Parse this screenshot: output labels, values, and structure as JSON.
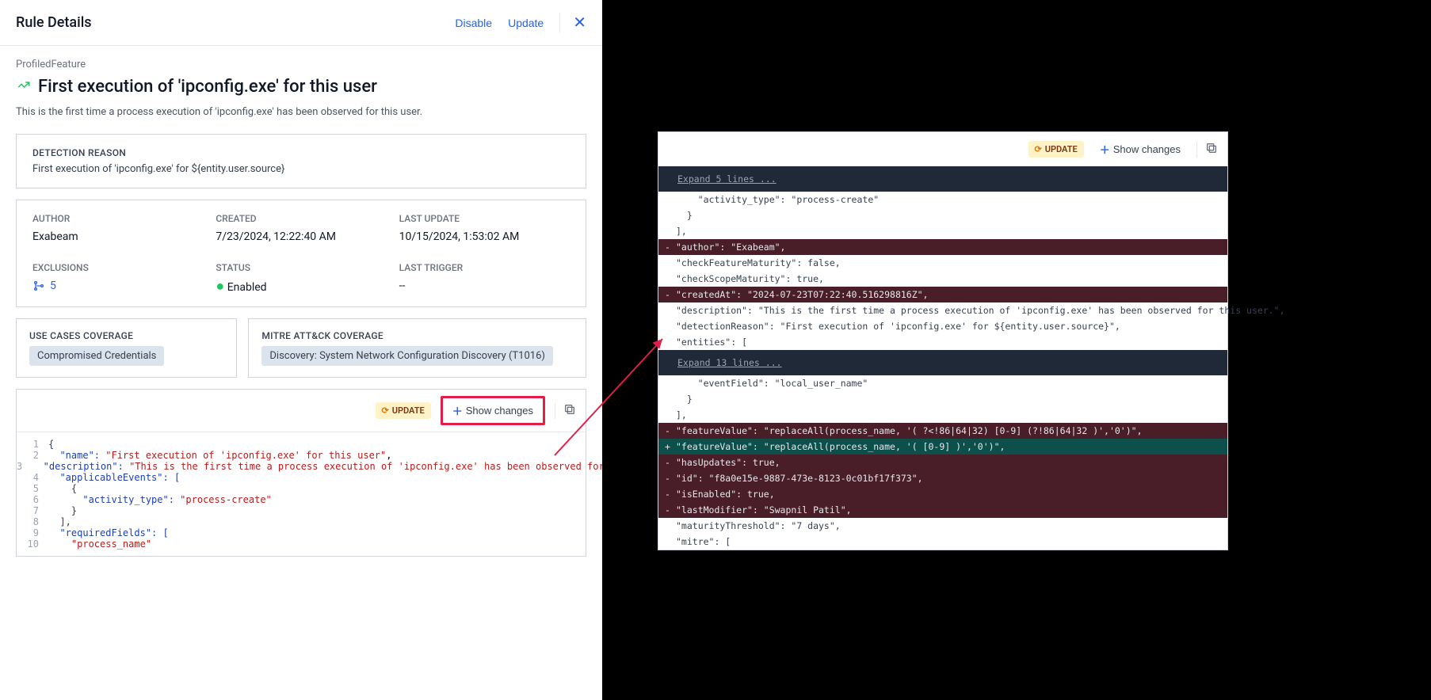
{
  "header": {
    "title": "Rule Details",
    "disable": "Disable",
    "update": "Update"
  },
  "rule": {
    "type": "ProfiledFeature",
    "title": "First execution of 'ipconfig.exe' for this user",
    "description": "This is the first time a process execution of 'ipconfig.exe' has been observed for this user."
  },
  "detection": {
    "label": "DETECTION REASON",
    "text": "First execution of 'ipconfig.exe' for ${entity.user.source}"
  },
  "meta": {
    "author_label": "AUTHOR",
    "author_value": "Exabeam",
    "created_label": "CREATED",
    "created_value": "7/23/2024, 12:22:40 AM",
    "updated_label": "LAST UPDATE",
    "updated_value": "10/15/2024, 1:53:02 AM",
    "exclusions_label": "EXCLUSIONS",
    "exclusions_count": "5",
    "status_label": "STATUS",
    "status_value": "Enabled",
    "trigger_label": "LAST TRIGGER",
    "trigger_value": "--"
  },
  "usecases": {
    "label": "USE CASES COVERAGE",
    "chip": "Compromised Credentials"
  },
  "mitre": {
    "label": "MITRE ATT&CK COVERAGE",
    "chip": "Discovery: System Network Configuration Discovery (T1016)"
  },
  "code_toolbar": {
    "update": "UPDATE",
    "show_changes": "Show changes"
  },
  "code": {
    "l1": "{",
    "l2a": "  \"name\": ",
    "l2b": "\"First execution of 'ipconfig.exe' for this user\"",
    "l2c": ",",
    "l3a": "  \"description\": ",
    "l3b": "\"This is the first time a process execution of 'ipconfig.exe' has been observed for this user.\"",
    "l3c": ",",
    "l4a": "  \"applicableEvents\": [",
    "l5": "    {",
    "l6a": "      \"activity_type\": ",
    "l6b": "\"process-create\"",
    "l7": "    }",
    "l8": "  ],",
    "l9a": "  \"requiredFields\": [",
    "l10": "    \"process_name\""
  },
  "diff": {
    "expand5": "Expand 5 lines ...",
    "expand13": "Expand 13 lines ...",
    "l_activity": "    \"activity_type\": \"process-create\"",
    "l_brace": "  }",
    "l_bracket": "],",
    "l_author": "\"author\": \"Exabeam\",",
    "l_cfm": "\"checkFeatureMaturity\": false,",
    "l_csm": "\"checkScopeMaturity\": true,",
    "l_created": "\"createdAt\": \"2024-07-23T07:22:40.516298816Z\",",
    "l_desc": "\"description\": \"This is the first time a process execution of 'ipconfig.exe' has been observed for this user.\",",
    "l_dr": "\"detectionReason\": \"First execution of 'ipconfig.exe' for ${entity.user.source}\",",
    "l_ent": "\"entities\": [",
    "l_ef": "    \"eventField\": \"local_user_name\"",
    "l_fv_old": "\"featureValue\": \"replaceAll(process_name, '( ?<!86|64|32) [0-9] (?!86|64|32 )','0')\",",
    "l_fv_new": "\"featureValue\": \"replaceAll(process_name, '( [0-9] )','0')\",",
    "l_hu": "\"hasUpdates\": true,",
    "l_id": "\"id\": \"f8a0e15e-9887-473e-8123-0c01bf17f373\",",
    "l_ie": "\"isEnabled\": true,",
    "l_lm": "\"lastModifier\": \"Swapnil Patil\",",
    "l_mt": "\"maturityThreshold\": \"7 days\",",
    "l_mitre": "\"mitre\": ["
  }
}
